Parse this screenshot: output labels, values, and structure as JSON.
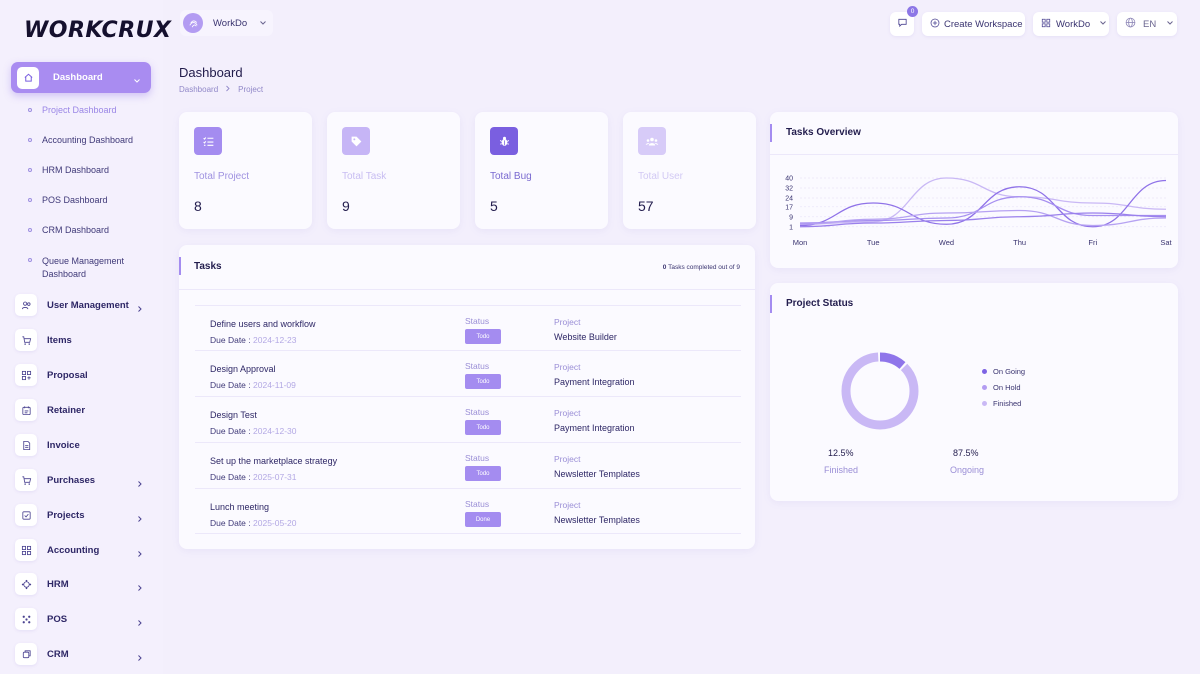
{
  "app": {
    "logo_text": "WORKCRUX"
  },
  "topbar": {
    "workspace": "WorkDo",
    "chat_badge": "0",
    "create_workspace": "Create Workspace",
    "workdo_label": "WorkDo",
    "language": "EN"
  },
  "sidebar": {
    "active": {
      "label": "Dashboard",
      "icon": "home-icon"
    },
    "subitems": [
      {
        "label": "Project Dashboard",
        "active": true
      },
      {
        "label": "Accounting Dashboard"
      },
      {
        "label": "HRM Dashboard"
      },
      {
        "label": "POS Dashboard"
      },
      {
        "label": "CRM Dashboard"
      },
      {
        "label": "Queue Management Dashboard"
      }
    ],
    "items": [
      {
        "label": "User Management",
        "icon": "users-icon",
        "chevron": true
      },
      {
        "label": "Items",
        "icon": "cart-icon",
        "chevron": false
      },
      {
        "label": "Proposal",
        "icon": "proposal-icon",
        "chevron": false
      },
      {
        "label": "Retainer",
        "icon": "retainer-icon",
        "chevron": false
      },
      {
        "label": "Invoice",
        "icon": "invoice-icon",
        "chevron": false
      },
      {
        "label": "Purchases",
        "icon": "cart-icon",
        "chevron": true
      },
      {
        "label": "Projects",
        "icon": "projects-icon",
        "chevron": true
      },
      {
        "label": "Accounting",
        "icon": "accounting-icon",
        "chevron": true
      },
      {
        "label": "HRM",
        "icon": "hrm-icon",
        "chevron": true
      },
      {
        "label": "POS",
        "icon": "pos-icon",
        "chevron": true
      },
      {
        "label": "CRM",
        "icon": "crm-icon",
        "chevron": true
      }
    ]
  },
  "header": {
    "title": "Dashboard",
    "breadcrumb": [
      "Dashboard",
      "Project"
    ]
  },
  "stats": [
    {
      "label": "Total Project",
      "value": "8",
      "icon": "list-check-icon",
      "color": "#a48cf0"
    },
    {
      "label": "Total Task",
      "value": "9",
      "icon": "tag-icon",
      "color": "#c6b5f6"
    },
    {
      "label": "Total Bug",
      "value": "5",
      "icon": "bug-icon",
      "color": "#7a5fe0"
    },
    {
      "label": "Total User",
      "value": "57",
      "icon": "users-icon",
      "color": "#d7cbf8"
    }
  ],
  "tasks": {
    "title": "Tasks",
    "summary_count": "0",
    "summary_text": "Tasks completed out of 9",
    "status_label": "Status",
    "project_label": "Project",
    "due_prefix": "Due Date :",
    "rows": [
      {
        "name": "Define users and workflow",
        "due": "2024-12-23",
        "status": "Todo",
        "project": "Website Builder"
      },
      {
        "name": "Design Approval",
        "due": "2024-11-09",
        "status": "Todo",
        "project": "Payment Integration"
      },
      {
        "name": "Design Test",
        "due": "2024-12-30",
        "status": "Todo",
        "project": "Payment Integration"
      },
      {
        "name": "Set up the marketplace strategy",
        "due": "2025-07-31",
        "status": "Todo",
        "project": "Newsletter Templates"
      },
      {
        "name": "Lunch meeting",
        "due": "2025-05-20",
        "status": "Done",
        "project": "Newsletter Templates"
      }
    ]
  },
  "chart_data": {
    "type": "line",
    "title": "Tasks Overview",
    "categories": [
      "Mon",
      "Tue",
      "Wed",
      "Thu",
      "Fri",
      "Sat"
    ],
    "y_ticks": [
      1,
      9,
      17,
      24,
      32,
      40
    ],
    "ylim": [
      0,
      40
    ],
    "grid": true,
    "series": [
      {
        "color": "#c9b8f5",
        "values": [
          3,
          5,
          40,
          25,
          20,
          15
        ]
      },
      {
        "color": "#8f72e8",
        "values": [
          2,
          20,
          3,
          33,
          1,
          38
        ]
      },
      {
        "color": "#a68ff0",
        "values": [
          4,
          6,
          8,
          25,
          10,
          10
        ]
      },
      {
        "color": "#b6a2f2",
        "values": [
          3,
          7,
          12,
          14,
          2,
          8
        ]
      },
      {
        "color": "#9a80ec",
        "values": [
          1,
          4,
          6,
          9,
          12,
          9
        ]
      }
    ]
  },
  "project_status": {
    "title": "Project Status",
    "legend": [
      {
        "label": "On Going",
        "color": "#7d63e4"
      },
      {
        "label": "On Hold",
        "color": "#b39cf2"
      },
      {
        "label": "Finished",
        "color": "#c9b8f5"
      }
    ],
    "donut": [
      {
        "label": "Finished",
        "value": 12.5,
        "color": "#8f75ea"
      },
      {
        "label": "Ongoing",
        "value": 87.5,
        "color": "#c9b8f5"
      }
    ],
    "stats": [
      {
        "pct": "12.5%",
        "label": "Finished"
      },
      {
        "pct": "87.5%",
        "label": "Ongoing"
      }
    ]
  }
}
